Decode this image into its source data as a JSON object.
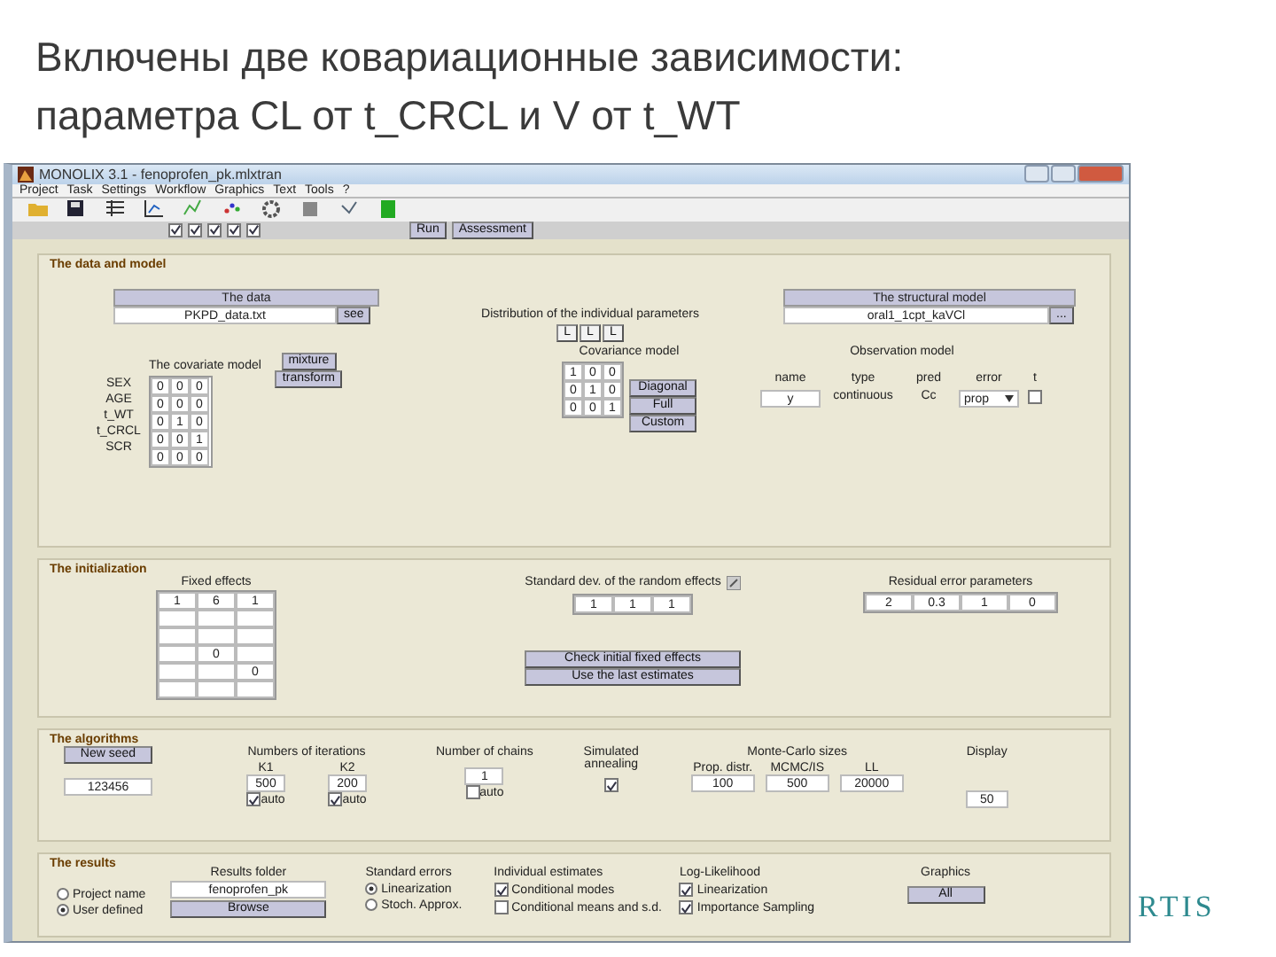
{
  "slide": {
    "title_lines": [
      "Включены две ковариационные зависимости:",
      "параметра CL от t_CRCL и V от t_WT"
    ],
    "logo": "RTIS"
  },
  "window": {
    "title": "MONOLIX 3.1 - fenoprofen_pk.mlxtran"
  },
  "menu": [
    "Project",
    "Task",
    "Settings",
    "Workflow",
    "Graphics",
    "Text",
    "Tools",
    "?"
  ],
  "tasks": [
    {
      "checked": true
    },
    {
      "checked": true
    },
    {
      "checked": true
    },
    {
      "checked": true
    },
    {
      "checked": true
    }
  ],
  "run_buttons": [
    "Run",
    "Assessment"
  ],
  "data_model": {
    "title": "The data and model",
    "data_label": "The data",
    "data_file": "PKPD_data.txt",
    "see_button": "see",
    "distribution_label": "Distribution of the individual parameters",
    "distribution_values": [
      "L",
      "L",
      "L"
    ],
    "structural_label": "The structural model",
    "structural_file": "oral1_1cpt_kaVCl",
    "structural_button": "...",
    "covariate_title": "The covariate model",
    "transform_buttons": [
      "mixture",
      "transform"
    ],
    "covariates": [
      {
        "name": "SEX",
        "values": [
          "0",
          "0",
          "0"
        ]
      },
      {
        "name": "AGE",
        "values": [
          "0",
          "0",
          "0"
        ]
      },
      {
        "name": "t_WT",
        "values": [
          "0",
          "1",
          "0"
        ]
      },
      {
        "name": "t_CRCL",
        "values": [
          "0",
          "0",
          "1"
        ]
      },
      {
        "name": "SCR",
        "values": [
          "0",
          "0",
          "0"
        ]
      }
    ],
    "covariance_title": "Covariance model",
    "covariance": [
      [
        "1",
        "0",
        "0"
      ],
      [
        "0",
        "1",
        "0"
      ],
      [
        "0",
        "0",
        "1"
      ]
    ],
    "covariance_buttons": [
      "Diagonal",
      "Full",
      "Custom"
    ],
    "observation_title": "Observation model",
    "observation_columns": [
      "name",
      "type",
      "pred",
      "error",
      "t"
    ],
    "observation_values": [
      "y",
      "continuous",
      "Cc",
      "prop"
    ],
    "observation_flag": {
      "checked": false
    }
  },
  "initialization": {
    "title": "The initialization",
    "fixed_label": "Fixed effects",
    "fixed_effects": [
      {
        "kind": "values",
        "column_1": "1",
        "column_2": "6",
        "column_3": "1"
      },
      {
        "kind": "empty"
      },
      {
        "kind": "empty"
      },
      {
        "kind": "values",
        "column_2": "0"
      },
      {
        "kind": "values",
        "column_3": "0"
      },
      {
        "kind": "empty"
      }
    ],
    "sd_label": "Standard dev. of the random effects",
    "sd_values": [
      "1",
      "1",
      "1"
    ],
    "residual_label": "Residual error parameters",
    "residual_values": [
      "2",
      "0.3",
      "1",
      "0"
    ],
    "buttons": [
      "Check initial fixed effects",
      "Use the last estimates"
    ]
  },
  "algorithms": {
    "title": "The algorithms",
    "seed_button": "New seed",
    "seed": "123456",
    "iterations_label": "Numbers of iterations",
    "iterations": [
      {
        "label": "K1",
        "value": "500",
        "auto": true,
        "auto_label": "auto"
      },
      {
        "label": "K2",
        "value": "200",
        "auto": true,
        "auto_label": "auto"
      }
    ],
    "chains_label": "Number of chains",
    "chains": {
      "value": "1",
      "auto": false,
      "auto_label": "auto"
    },
    "annealing_label": "Simulated annealing",
    "annealing": {
      "checked": true
    },
    "mc_label": "Monte-Carlo sizes",
    "mc": [
      {
        "label": "Prop. distr.",
        "value": "100"
      },
      {
        "label": "MCMC/IS",
        "value": "500"
      },
      {
        "label": "LL",
        "value": "20000"
      }
    ],
    "display_label": "Display",
    "display": "50"
  },
  "results": {
    "title": "The results",
    "folder_options": [
      {
        "label": "Project name",
        "selected": false
      },
      {
        "label": "User defined",
        "selected": true
      }
    ],
    "folder_label": "Results folder",
    "folder": "fenoprofen_pk",
    "browse_button": "Browse",
    "se_label": "Standard errors",
    "se_options": [
      {
        "label": "Linearization",
        "selected": true
      },
      {
        "label": "Stoch. Approx.",
        "selected": false
      }
    ],
    "ind_label": "Individual estimates",
    "ind_options": [
      {
        "label": "Conditional modes",
        "checked": true
      },
      {
        "label": "Conditional means and s.d.",
        "checked": false
      }
    ],
    "ll_label": "Log-Likelihood",
    "ll_options": [
      {
        "label": "Linearization",
        "checked": true
      },
      {
        "label": "Importance Sampling",
        "checked": true
      }
    ],
    "graphics_label": "Graphics",
    "graphics_button": "All"
  }
}
